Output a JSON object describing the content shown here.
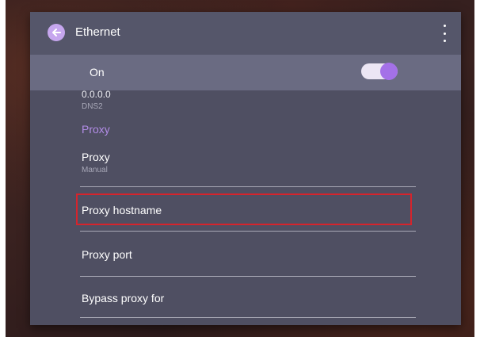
{
  "header": {
    "title": "Ethernet",
    "back_icon": "back-arrow-icon",
    "menu_icon": "more-vert-icon"
  },
  "ethernet_toggle": {
    "label": "On",
    "state": true,
    "accent": "#a471e8"
  },
  "dns2": {
    "value": "0.0.0.0",
    "label": "DNS2"
  },
  "proxy_section": {
    "header": "Proxy",
    "proxy_item": {
      "title": "Proxy",
      "value": "Manual"
    },
    "hostname_label": "Proxy hostname",
    "port_label": "Proxy port",
    "bypass_label": "Bypass proxy for"
  },
  "colors": {
    "panel": "#4f4f62",
    "title_bar": "#55566a",
    "on_bar": "#6a6b82",
    "section_header": "#b28ce6",
    "highlight_box": "#d6242c"
  }
}
